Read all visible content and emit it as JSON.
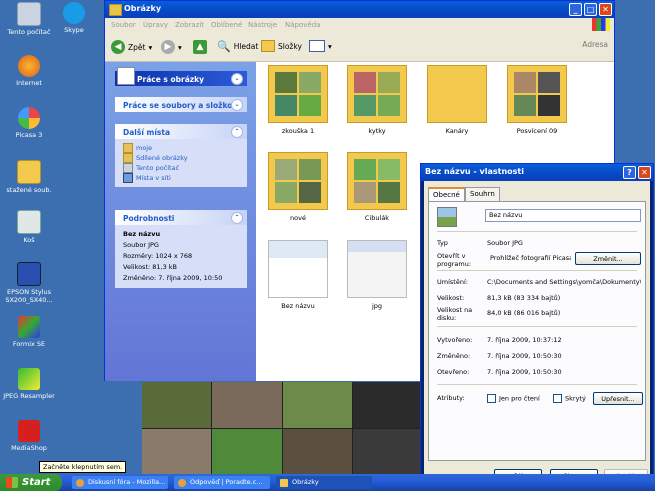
{
  "desktop": {
    "icons": [
      {
        "label": "Tento počítač",
        "icon": "my-computer-icon"
      },
      {
        "label": "Skype",
        "icon": "skype-icon"
      },
      {
        "label": "Internet",
        "icon": "firefox-icon"
      },
      {
        "label": "Picasa 3",
        "icon": "picasa-icon"
      },
      {
        "label": "stažené soub.",
        "icon": "folder-icon"
      },
      {
        "label": "Koš",
        "icon": "recycle-bin-icon"
      },
      {
        "label": "EPSON Stylus SX200_SX40...",
        "icon": "printer-icon"
      },
      {
        "label": "Formix SE",
        "icon": "formix-icon"
      },
      {
        "label": "JPEG Resampler",
        "icon": "jpeg-resampler-icon"
      },
      {
        "label": "MediaShop",
        "icon": "mediashop-icon"
      }
    ]
  },
  "explorer": {
    "title": "Obrázky",
    "menu": [
      "Soubor",
      "Úpravy",
      "Zobrazit",
      "Oblíbené",
      "Nástroje",
      "Nápověda"
    ],
    "toolbar": {
      "back": "Zpět",
      "search": "Hledat",
      "folders": "Složky",
      "address": "Adresa"
    },
    "tasks": {
      "picture_tasks": "Práce s obrázky",
      "file_tasks": "Práce se soubory a složkou",
      "other_places": "Další místa",
      "places": [
        "moje",
        "Sdílené obrázky",
        "Tento počítač",
        "Místa v síti"
      ],
      "details_title": "Podrobnosti",
      "details": {
        "name": "Bez názvu",
        "type": "Soubor JPG",
        "dimensions": "Rozměry: 1024 x 768",
        "size": "Velikost: 81,3 kB",
        "modified": "Změněno: 7. října 2009, 10:50"
      }
    },
    "items": [
      {
        "label": "zkouška 1",
        "kind": "folder"
      },
      {
        "label": "kytky",
        "kind": "folder"
      },
      {
        "label": "Kanáry",
        "kind": "folder"
      },
      {
        "label": "Posvícení 09",
        "kind": "folder"
      },
      {
        "label": "nové",
        "kind": "folder"
      },
      {
        "label": "Cibulák",
        "kind": "folder"
      },
      {
        "label": "Bez názvu",
        "kind": "file"
      },
      {
        "label": "jpg",
        "kind": "file"
      }
    ]
  },
  "properties": {
    "title": "Bez názvu - vlastnosti",
    "tabs": [
      "Obecné",
      "Souhrn"
    ],
    "name": "Bez názvu",
    "type_label": "Typ",
    "type_value": "Soubor JPG",
    "open_with_label": "Otevřít v programu:",
    "open_with_value": "Prohlížeč fotografií Picasa",
    "change_button": "Změnit...",
    "location_label": "Umístění:",
    "location_value": "C:\\Documents and Settings\\yomča\\Dokumenty\\obr",
    "size_label": "Velikost:",
    "size_value": "81,3 kB (83 334 bajtů)",
    "disk_size_label": "Velikost na disku:",
    "disk_size_value": "84,0 kB (86 016 bajtů)",
    "created_label": "Vytvořeno:",
    "created_value": "7. října 2009, 10:37:12",
    "modified_label": "Změněno:",
    "modified_value": "7. října 2009, 10:50:30",
    "accessed_label": "Otevřeno:",
    "accessed_value": "7. října 2009, 10:50:30",
    "attributes_label": "Atributy:",
    "readonly_label": "Jen pro čtení",
    "hidden_label": "Skrytý",
    "advanced_button": "Upřesnit...",
    "ok": "OK",
    "cancel": "Storno",
    "apply": "Použít"
  },
  "taskbar": {
    "start": "Start",
    "tooltip": "Začněte klepnutím sem.",
    "tasks": [
      "Diskusní fóra - Mozilla...",
      "Odpověď | Poradte.c...",
      "Obrázky"
    ]
  }
}
